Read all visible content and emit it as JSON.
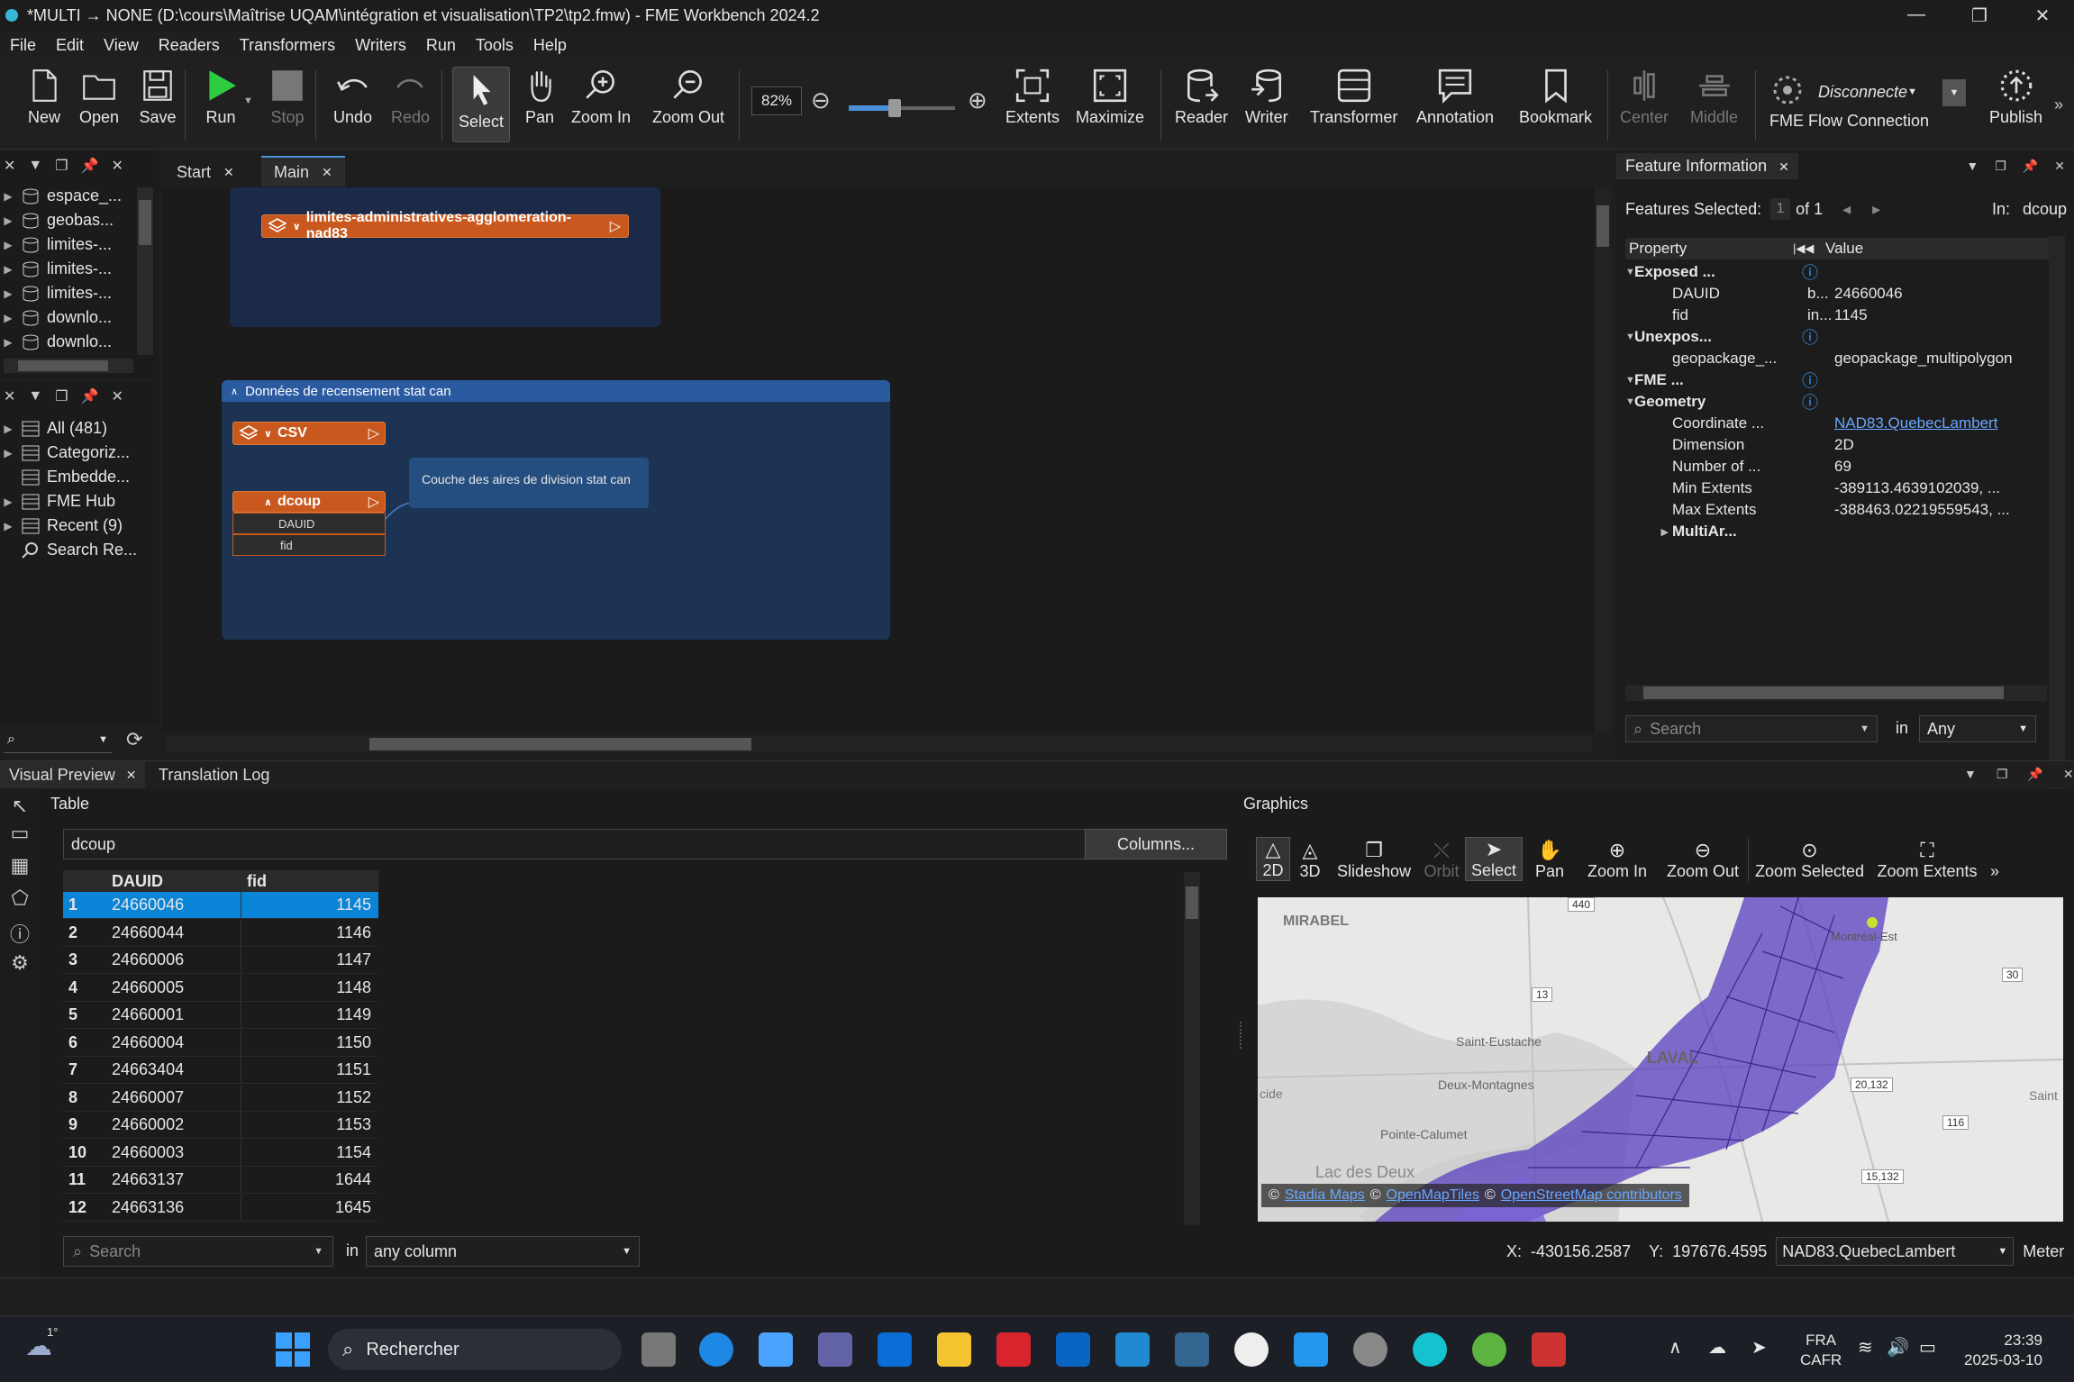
{
  "window": {
    "title": "*MULTI → NONE (D:\\cours\\Maîtrise UQAM\\intégration et visualisation\\TP2\\tp2.fmw) - FME Workbench 2024.2",
    "min": "—",
    "max": "❐",
    "close": "✕"
  },
  "menu": [
    "File",
    "Edit",
    "View",
    "Readers",
    "Transformers",
    "Writers",
    "Run",
    "Tools",
    "Help"
  ],
  "toolbar": {
    "new": "New",
    "open": "Open",
    "save": "Save",
    "run": "Run",
    "stop": "Stop",
    "undo": "Undo",
    "redo": "Redo",
    "select": "Select",
    "pan": "Pan",
    "zoom_in": "Zoom In",
    "zoom_out": "Zoom Out",
    "zoom_level": "82%",
    "extents": "Extents",
    "maximize": "Maximize",
    "reader": "Reader",
    "writer": "Writer",
    "transformer": "Transformer",
    "annotation": "Annotation",
    "bookmark": "Bookmark",
    "center": "Center",
    "middle": "Middle",
    "flow_status": "Disconnecte",
    "flow_label": "FME Flow Connection",
    "publish": "Publish"
  },
  "navigator": {
    "items": [
      "espace_...",
      "geobas...",
      "limites-...",
      "limites-...",
      "limites-...",
      "downlo...",
      "downlo..."
    ]
  },
  "gallery": {
    "items": [
      "All (481)",
      "Categoriz...",
      "Embedde...",
      "FME Hub",
      "Recent (9)",
      "Search Re..."
    ]
  },
  "tabs": {
    "start": "Start",
    "main": "Main"
  },
  "canvas": {
    "reader1": "limites-administratives-agglomeration-nad83",
    "bookmark_title": "Données de recensement stat can",
    "csv": "CSV",
    "dcoup": "dcoup",
    "attr1": "DAUID",
    "attr2": "fid",
    "annotation": "Couche des aires de division stat can"
  },
  "feature_info": {
    "title": "Feature Information",
    "selected_label": "Features Selected:",
    "selected_value": "1",
    "of": "of 1",
    "in_label": "In:",
    "in_value": "dcoup",
    "col_property": "Property",
    "col_value": "Value",
    "rows": [
      {
        "p": "Exposed ...",
        "v": "",
        "bold": true,
        "lvl": 0
      },
      {
        "p": "DAUID",
        "t": "b...",
        "v": "24660046",
        "lvl": 1
      },
      {
        "p": "fid",
        "t": "in...",
        "v": "1145",
        "lvl": 1
      },
      {
        "p": "Unexpos...",
        "v": "",
        "bold": true,
        "lvl": 0
      },
      {
        "p": "geopackage_...",
        "v": "geopackage_multipolygon",
        "lvl": 1
      },
      {
        "p": "FME ...",
        "v": "",
        "bold": true,
        "lvl": 0
      },
      {
        "p": "Geometry",
        "v": "",
        "bold": true,
        "lvl": 0
      },
      {
        "p": "Coordinate ...",
        "v": "NAD83.QuebecLambert",
        "lvl": 1
      },
      {
        "p": "Dimension",
        "v": "2D",
        "lvl": 1
      },
      {
        "p": "Number of ...",
        "v": "69",
        "lvl": 1
      },
      {
        "p": "Min Extents",
        "v": "-389113.4639102039, ...",
        "lvl": 1
      },
      {
        "p": "Max Extents",
        "v": "-388463.02219559543, ...",
        "lvl": 1
      },
      {
        "p": "MultiAr...",
        "v": "",
        "bold": true,
        "lvl": 1
      }
    ],
    "search_placeholder": "Search",
    "in": "in",
    "any": "Any"
  },
  "bottom_tabs": {
    "visual": "Visual Preview",
    "log": "Translation Log"
  },
  "table": {
    "label": "Table",
    "dataset": "dcoup",
    "columns_btn": "Columns...",
    "col1": "DAUID",
    "col2": "fid",
    "rows": [
      [
        "1",
        "24660046",
        "1145"
      ],
      [
        "2",
        "24660044",
        "1146"
      ],
      [
        "3",
        "24660006",
        "1147"
      ],
      [
        "4",
        "24660005",
        "1148"
      ],
      [
        "5",
        "24660001",
        "1149"
      ],
      [
        "6",
        "24660004",
        "1150"
      ],
      [
        "7",
        "24663404",
        "1151"
      ],
      [
        "8",
        "24660007",
        "1152"
      ],
      [
        "9",
        "24660002",
        "1153"
      ],
      [
        "10",
        "24660003",
        "1154"
      ],
      [
        "11",
        "24663137",
        "1644"
      ],
      [
        "12",
        "24663136",
        "1645"
      ]
    ],
    "search_placeholder": "Search",
    "in": "in",
    "any_column": "any column"
  },
  "graphics": {
    "label": "Graphics",
    "tools": [
      "2D",
      "3D",
      "Slideshow",
      "Orbit",
      "Select",
      "Pan",
      "Zoom In",
      "Zoom Out",
      "Zoom Selected",
      "Zoom Extents"
    ],
    "map_labels": [
      "MIRABEL",
      "LAVAL",
      "Saint-Eustache",
      "Deux-Montagnes",
      "Pointe-Calumet",
      "Lac des Deux",
      "Montréal-Est",
      "Saint",
      "cide"
    ],
    "road_labels": [
      "440",
      "13",
      "30",
      "116",
      "15,132",
      "20,132"
    ],
    "attribution": [
      "©",
      "Stadia Maps",
      "©",
      "OpenMapTiles",
      "©",
      "OpenStreetMap contributors"
    ],
    "x_label": "X:",
    "x": "-430156.2587",
    "y_label": "Y:",
    "y": "197676.4595",
    "crs": "NAD83.QuebecLambert",
    "unit": "Meter"
  },
  "taskbar": {
    "weather": "1°",
    "search": "Rechercher",
    "lang1": "FRA",
    "lang2": "CAFR",
    "time": "23:39",
    "date": "2025-03-10"
  },
  "colors": {
    "accent": "#c8581e",
    "bookmark": "#1e3a5f",
    "map_poly": "#5a3fbf",
    "selected": "#0a84d6"
  }
}
